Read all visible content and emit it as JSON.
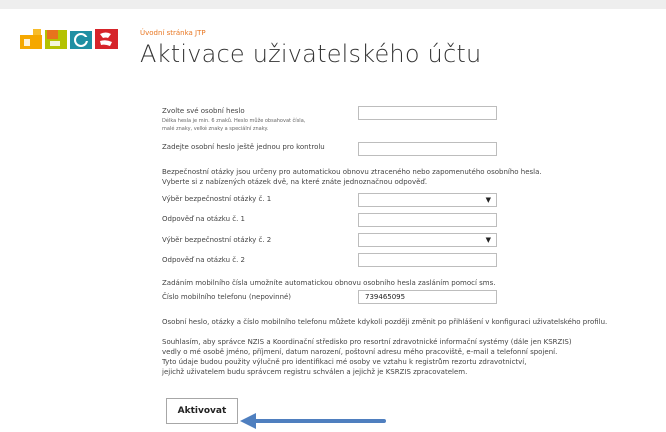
{
  "breadcrumb": "Úvodní stránka JTP",
  "page_title": "Aktivace uživatelského účtu",
  "form": {
    "password_label": "Zvolte své osobní heslo",
    "password_hint_1": "Délka hesla je min. 6 znaků. Heslo může obsahovat čísla,",
    "password_hint_2": "malé znaky, velké znaky a speciální znaky.",
    "password_confirm_label": "Zadejte osobní heslo ještě jednou pro kontrolu",
    "questions_info_1": "Bezpečnostní otázky jsou určeny pro automatickou obnovu ztraceného nebo zapomenutého osobního hesla.",
    "questions_info_2": "Vyberte si z nabízených otázek dvě, na které znáte jednoznačnou odpověď.",
    "question1_label": "Výběr bezpečnostní otázky č. 1",
    "answer1_label": "Odpověď na otázku č. 1",
    "question2_label": "Výběr bezpečnostní otázky č. 2",
    "answer2_label": "Odpověď na otázku č. 2",
    "mobile_info": "Zadáním mobilního čísla umožníte automatickou obnovu osobního hesla zasláním pomocí sms.",
    "mobile_label": "Číslo mobilního telefonu (nepovinné)",
    "mobile_value": "739465095",
    "change_info": "Osobní heslo, otázky a číslo mobilního telefonu můžete kdykoli později změnit po přihlášení v konfiguraci uživatelského profilu.",
    "consent_lines": [
      "Souhlasím, aby správce NZIS a Koordinační středisko pro resortní zdravotnické informační systémy (dále jen KSRZIS)",
      "vedly o mé osobě jméno, příjmení, datum narození, poštovní adresu mého pracoviště, e-mail a telefonní spojení.",
      "Tyto údaje budou použity výlučně pro identifikaci mé osoby ve vztahu k registrům rezortu zdravotnictví,",
      "jejichž uživatelem budu správcem registru schválen a jejichž je KSRZIS zpracovatelem."
    ],
    "activate_label": "Aktivovat"
  },
  "icons": {
    "dropdown": "▼",
    "logo": "jtp-logo",
    "annotation": "arrow-left-icon"
  },
  "colors": {
    "breadcrumb": "#e87722",
    "logo_yellow": "#f5a800",
    "logo_orange": "#e8731c",
    "logo_lime": "#b5c200",
    "logo_teal": "#1f8fa3",
    "logo_red": "#d6242a",
    "arrow": "#4f7fbf"
  }
}
